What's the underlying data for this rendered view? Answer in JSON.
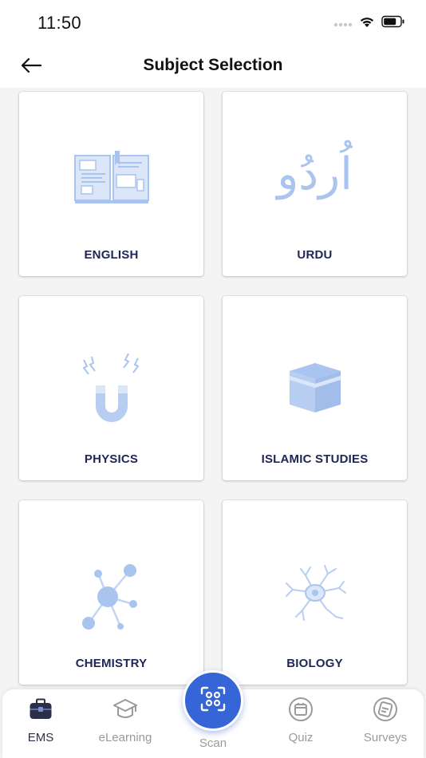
{
  "status": {
    "time": "11:50"
  },
  "header": {
    "title": "Subject Selection",
    "back_icon": "arrow-left-icon"
  },
  "subjects": [
    {
      "label": "ENGLISH",
      "icon": "open-book-illustration"
    },
    {
      "label": "URDU",
      "icon": "urdu-script-illustration",
      "script_text": "اُردُو"
    },
    {
      "label": "PHYSICS",
      "icon": "magnet-illustration"
    },
    {
      "label": "ISLAMIC STUDIES",
      "icon": "kaaba-illustration"
    },
    {
      "label": "CHEMISTRY",
      "icon": "molecule-illustration"
    },
    {
      "label": "BIOLOGY",
      "icon": "neuron-illustration"
    }
  ],
  "bottom_nav": {
    "items": [
      {
        "label": "EMS",
        "icon": "briefcase-icon",
        "active": true
      },
      {
        "label": "eLearning",
        "icon": "graduation-cap-icon",
        "active": false
      },
      {
        "label": "Scan",
        "icon": "scan-face-icon",
        "active": false
      },
      {
        "label": "Quiz",
        "icon": "quiz-icon",
        "active": false
      },
      {
        "label": "Surveys",
        "icon": "survey-icon",
        "active": false
      }
    ]
  },
  "colors": {
    "accent": "#3565d6",
    "illustration": "#a9c4ee",
    "label": "#1f2555",
    "inactive_nav": "#9a9a9a"
  }
}
